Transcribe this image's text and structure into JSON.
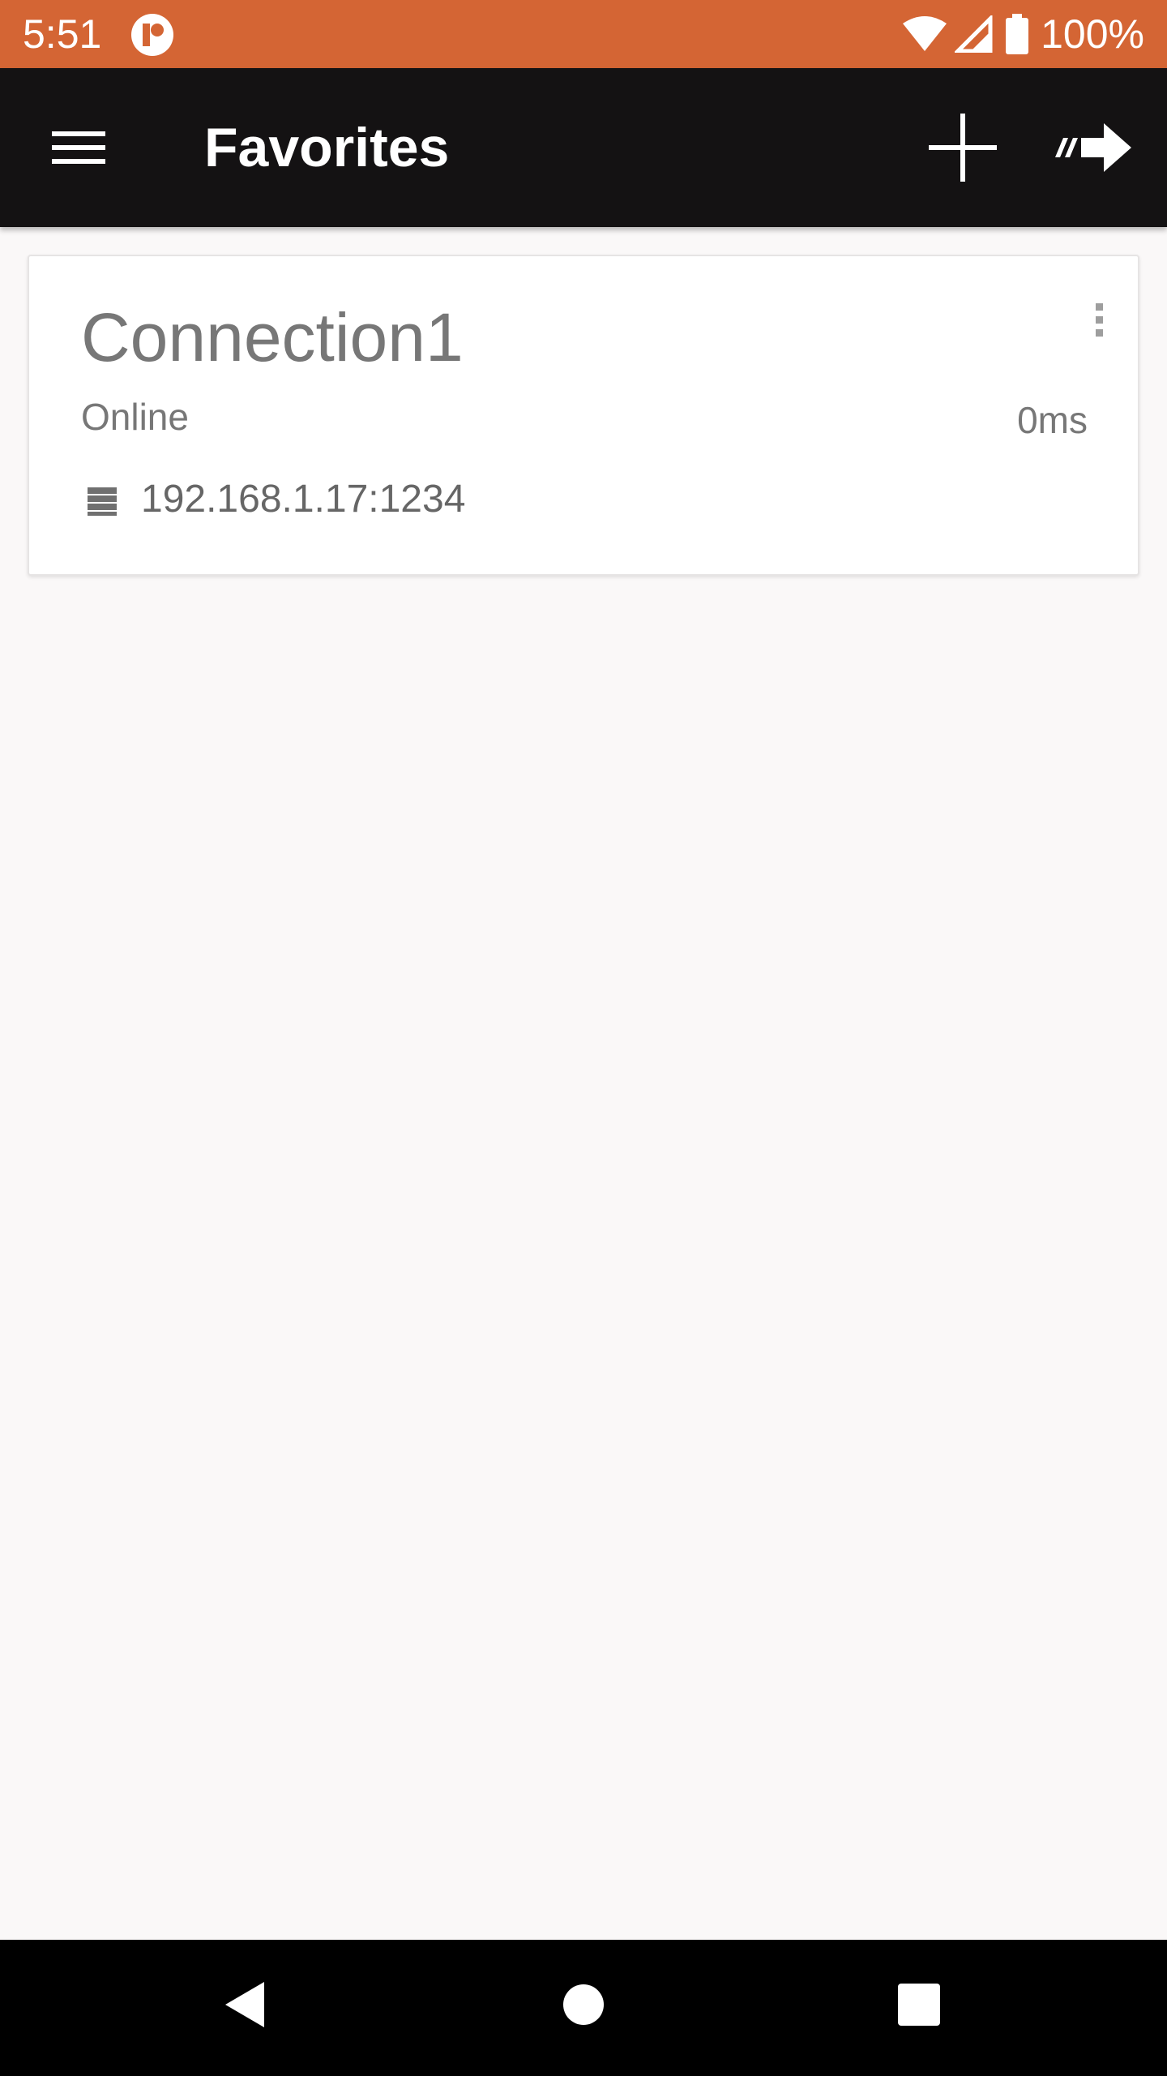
{
  "status_bar": {
    "time": "5:51",
    "battery_text": "100%",
    "background_color": "#d46534",
    "icons": [
      "app-notification-icon",
      "wifi-icon",
      "cell-signal-icon",
      "battery-icon"
    ]
  },
  "app_bar": {
    "title": "Favorites",
    "background_color": "#141213",
    "icons": {
      "menu": "menu-icon",
      "add": "add-icon",
      "connect": "connect-arrow-icon"
    }
  },
  "favorites": [
    {
      "name": "Connection1",
      "status": "Online",
      "ping": "0ms",
      "address": "192.168.1.17:1234",
      "icons": {
        "more": "more-vert-icon",
        "server": "server-icon"
      }
    }
  ],
  "nav_bar": {
    "icons": [
      "back-icon",
      "home-icon",
      "recents-icon"
    ]
  }
}
